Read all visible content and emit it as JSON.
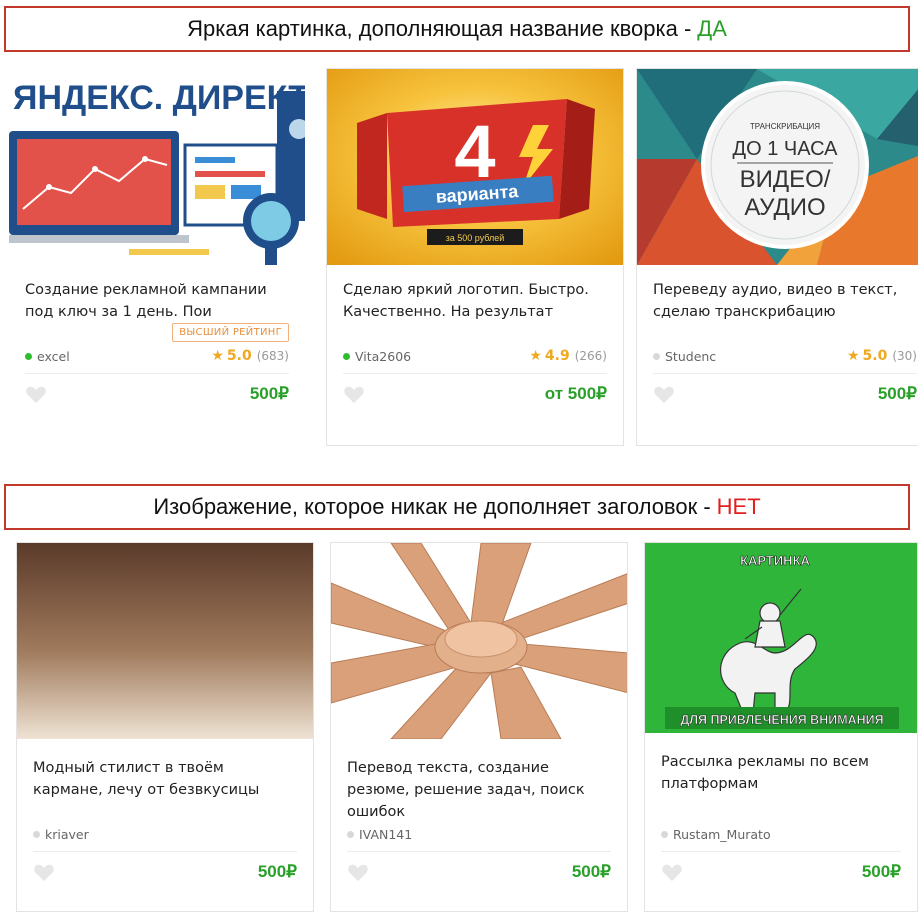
{
  "banners": {
    "top": {
      "text": "Яркая картинка, дополняющая название кворка -",
      "verdict": "ДА"
    },
    "bottom": {
      "text": "Изображение, которое никак не дополняет заголовок -",
      "verdict": "НЕТ"
    }
  },
  "cards_good": [
    {
      "thumb_text": "ЯНДЕКС. ДИРЕКТ",
      "title": "Создание рекламной кампании под ключ за 1 день. Пои",
      "badge": "ВЫСШИЙ РЕЙТИНГ",
      "seller": "excel",
      "rating": "5.0",
      "count": "(683)",
      "price": "500₽"
    },
    {
      "thumb_number": "4",
      "thumb_text": "варианта",
      "thumb_sub": "за 500 рублей",
      "title": "Сделаю яркий логотип. Быстро. Качественно. На результат",
      "seller": "Vita2606",
      "rating": "4.9",
      "count": "(266)",
      "price": "от 500₽"
    },
    {
      "thumb_small": "ТРАНСКРИБАЦИЯ",
      "thumb_line1": "ДО 1 ЧАСА",
      "thumb_line2": "ВИДЕО/",
      "thumb_line3": "АУДИО",
      "title": "Переведу аудио, видео в текст, сделаю транскрибацию",
      "seller": "Studenc",
      "rating": "5.0",
      "count": "(30)",
      "price": "500₽"
    }
  ],
  "cards_bad": [
    {
      "title": "Модный стилист в твоём кармане, лечу от безвкусицы",
      "seller": "kriaver",
      "price": "500₽"
    },
    {
      "title": "Перевод текста, создание резюме, решение задач, поиск ошибок",
      "seller": "IVAN141",
      "price": "500₽"
    },
    {
      "thumb_top": "КАРТИНКА",
      "thumb_bottom": "ДЛЯ ПРИВЛЕЧЕНИЯ ВНИМАНИЯ",
      "title": "Рассылка рекламы по всем платформам",
      "seller": "Rustam_Murato",
      "price": "500₽"
    }
  ],
  "colors": {
    "accent_green": "#2aa02a",
    "verdict_red": "#e02020",
    "banner_border": "#c0392b",
    "star": "#f0a820"
  }
}
